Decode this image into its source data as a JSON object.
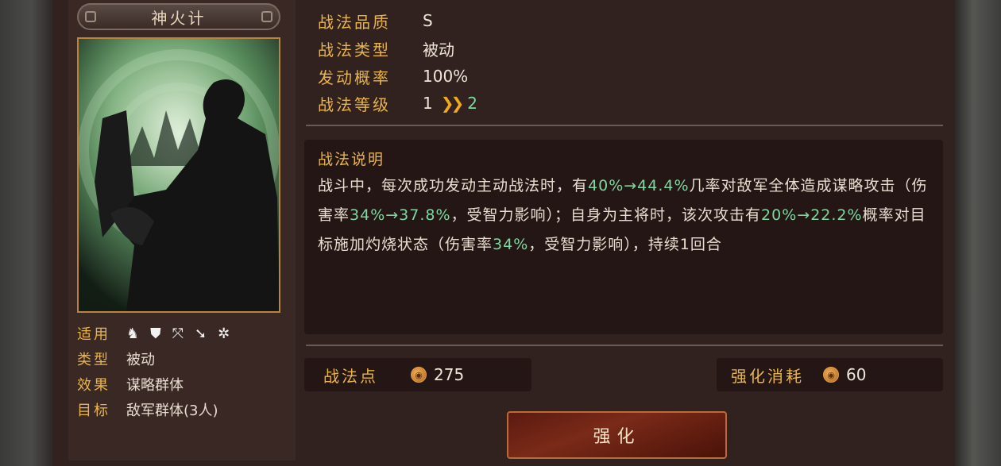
{
  "card": {
    "title": "神火计"
  },
  "meta": {
    "applies_label": "适用",
    "applies_icons": [
      "cavalry-icon",
      "shield-icon",
      "bow-icon",
      "spear-icon",
      "wheel-icon"
    ],
    "type_label": "类型",
    "type_value": "被动",
    "effect_label": "效果",
    "effect_value": "谋略群体",
    "target_label": "目标",
    "target_value": "敌军群体(3人)"
  },
  "stats": {
    "quality_label": "战法品质",
    "quality_value": "S",
    "kind_label": "战法类型",
    "kind_value": "被动",
    "rate_label": "发动概率",
    "rate_value": "100%",
    "level_label": "战法等级",
    "level_current": "1",
    "level_next": "2"
  },
  "description": {
    "title": "战法说明",
    "t1": "战斗中，每次成功发动主动战法时，有",
    "h1": "40%→44.4%",
    "t2": "几率对敌军全体造成谋略攻击（伤害率",
    "h2": "34%→37.8%",
    "t3": "，受智力影响）；自身为主将时，该次攻击有",
    "h3": "20%→22.2%",
    "t4": "概率对目标施加灼烧状态（伤害率",
    "h4": "34%",
    "t5": "，受智力影响），持续1回合"
  },
  "resources": {
    "points_label": "战法点",
    "points_value": "275",
    "cost_label": "强化消耗",
    "cost_value": "60"
  },
  "actions": {
    "upgrade_label": "强化"
  },
  "colors": {
    "accent_gold": "#e9b449",
    "highlight_green": "#7fd6a0",
    "panel_bg": "#32221f"
  }
}
